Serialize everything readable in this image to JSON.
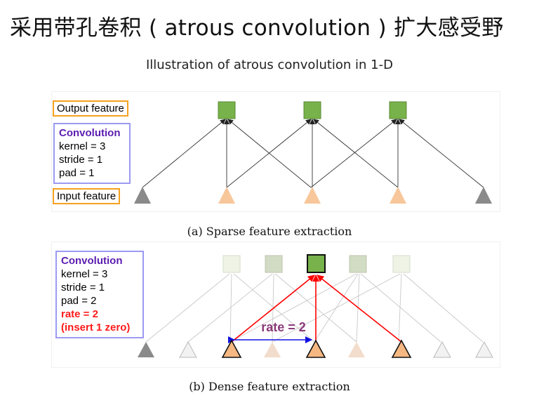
{
  "title": "采用带孔卷积 ( atrous convolution ) 扩大感受野",
  "subtitle": "Illustration of atrous convolution in 1-D",
  "panel_a": {
    "output_label": "Output feature",
    "input_label": "Input feature",
    "conv_title": "Convolution",
    "lines": [
      "kernel = 3",
      "stride = 1",
      "pad = 1"
    ],
    "caption": "(a) Sparse feature extraction"
  },
  "panel_b": {
    "conv_title": "Convolution",
    "lines": [
      "kernel = 3",
      "stride = 1",
      "pad = 2"
    ],
    "red_lines": [
      "rate = 2",
      "(insert 1 zero)"
    ],
    "rate_label": "rate = 2",
    "caption": "(b) Dense feature extraction"
  },
  "colors": {
    "output_square": "#78b24a",
    "input_triangle": "#f7c79b",
    "pad_triangle": "#8a8a8a",
    "highlight_line": "#ff0000",
    "rate_arrow": "#1010e0",
    "rate_text": "#8b3a7a",
    "label_box_orange": "#f5a11e",
    "label_box_blue": "#9b9bf2"
  }
}
